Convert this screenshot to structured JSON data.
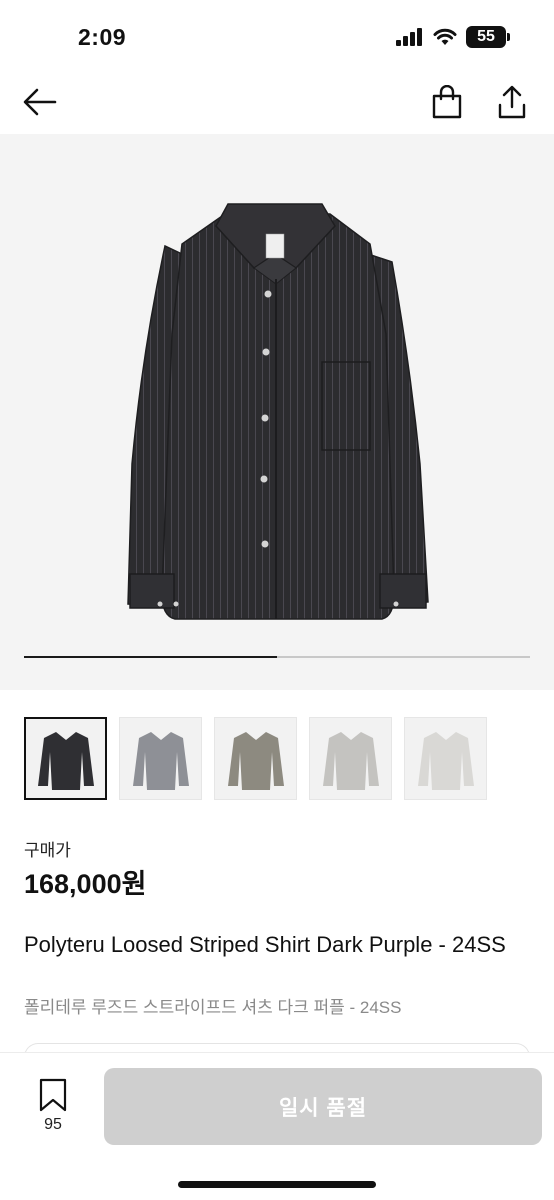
{
  "status_bar": {
    "time": "2:09",
    "battery": "55"
  },
  "nav": {
    "back_icon": "arrow-left-icon",
    "bag_icon": "shopping-bag-icon",
    "share_icon": "share-icon"
  },
  "gallery": {
    "image_progress": 0.5,
    "thumbnails": [
      {
        "color": "dark-charcoal",
        "selected": true
      },
      {
        "color": "gray",
        "selected": false
      },
      {
        "color": "khaki-gray",
        "selected": false
      },
      {
        "color": "light-gray",
        "selected": false
      },
      {
        "color": "off-white",
        "selected": false
      }
    ]
  },
  "price": {
    "label": "구매가",
    "value": "168,000원"
  },
  "product": {
    "title_en": "Polyteru Loosed Striped Shirt Dark Purple - 24SS",
    "title_ko": "폴리테루 루즈드 스트라이프드 셔츠 다크 퍼플 - 24SS"
  },
  "bottom": {
    "bookmark_count": "95",
    "soldout_label": "일시 품절"
  },
  "colors": {
    "accent": "#111111",
    "disabled_button": "#cfcfcf",
    "subtle_text": "#8a8a8a"
  }
}
